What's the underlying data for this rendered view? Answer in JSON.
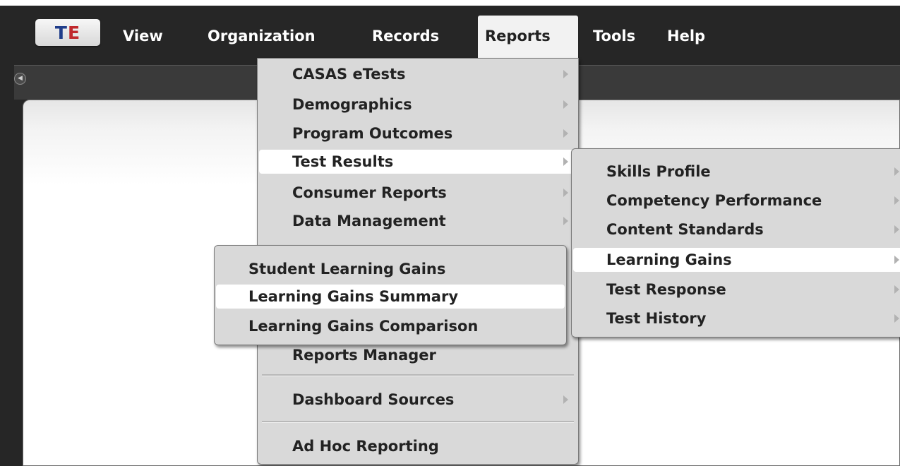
{
  "logo": {
    "t": "T",
    "e": "E"
  },
  "menubar": {
    "items": [
      "View",
      "Organization",
      "Records",
      "Reports",
      "Tools",
      "Help"
    ]
  },
  "reports_menu": {
    "items": [
      {
        "label": "CASAS eTests",
        "has_submenu": true
      },
      {
        "label": "Demographics",
        "has_submenu": true
      },
      {
        "label": "Program Outcomes",
        "has_submenu": true
      },
      {
        "label": "Test Results",
        "has_submenu": true
      },
      {
        "label": "Consumer Reports",
        "has_submenu": true
      },
      {
        "label": "Data Management",
        "has_submenu": true
      },
      {
        "label": "Reports Manager",
        "has_submenu": false
      },
      {
        "label": "Dashboard Sources",
        "has_submenu": true
      },
      {
        "label": "Ad Hoc Reporting",
        "has_submenu": false
      }
    ]
  },
  "test_results_menu": {
    "items": [
      {
        "label": "Skills Profile",
        "has_submenu": true
      },
      {
        "label": "Competency Performance",
        "has_submenu": true
      },
      {
        "label": "Content Standards",
        "has_submenu": true
      },
      {
        "label": "Learning Gains",
        "has_submenu": true
      },
      {
        "label": "Test Response",
        "has_submenu": true
      },
      {
        "label": "Test History",
        "has_submenu": true
      }
    ]
  },
  "learning_gains_menu": {
    "items": [
      {
        "label": "Student Learning Gains"
      },
      {
        "label": "Learning Gains Summary"
      },
      {
        "label": "Learning Gains Comparison"
      }
    ]
  },
  "icons": {
    "back": "circle-arrow-left-icon",
    "submenu": "triangle-right-icon"
  },
  "colors": {
    "menubar_bg": "#262626",
    "menu_bg": "#d9d9d9",
    "highlight_bg": "#ffffff",
    "logo_t": "#1f3d8a",
    "logo_e": "#c0282d"
  }
}
